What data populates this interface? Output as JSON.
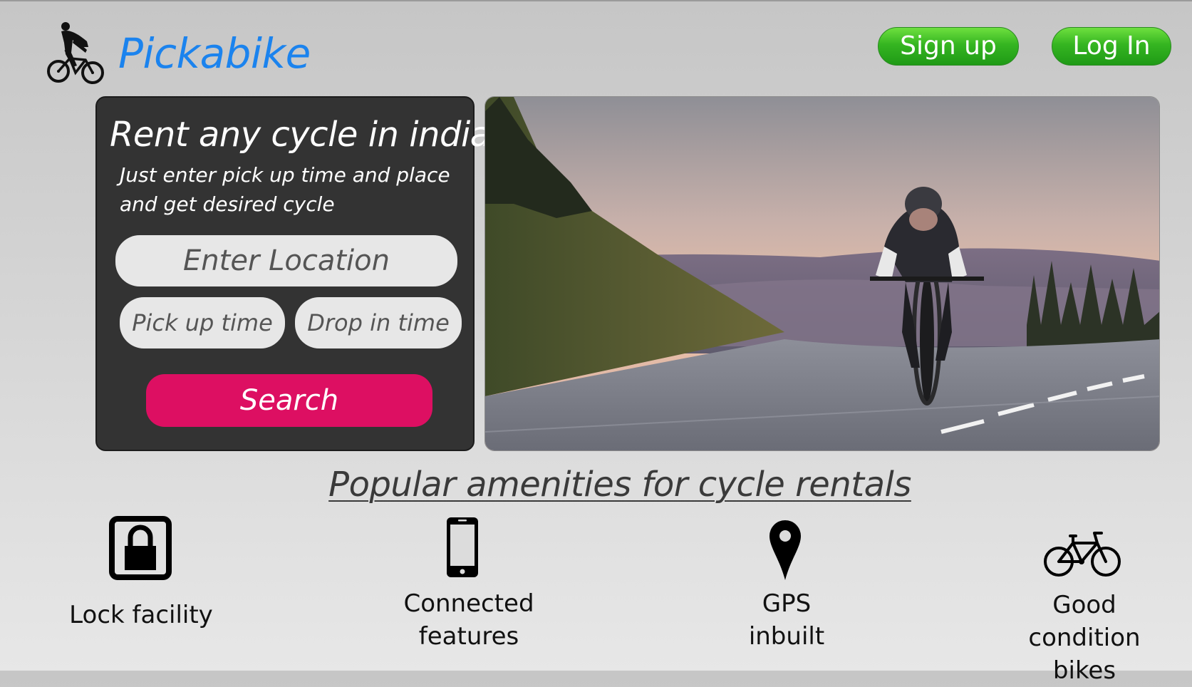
{
  "header": {
    "brand": "Pickabike",
    "signup_label": "Sign up",
    "login_label": "Log In"
  },
  "search_panel": {
    "title": "Rent any cycle in india",
    "subtitle": "Just enter pick up time and place and get desired cycle",
    "location_placeholder": "Enter Location",
    "pickup_placeholder": "Pick up time",
    "drop_placeholder": "Drop in time",
    "search_label": "Search"
  },
  "amenities": {
    "title": "Popular amenities for cycle rentals",
    "items": [
      {
        "icon": "lock-icon",
        "label": "Lock facility"
      },
      {
        "icon": "phone-icon",
        "label": "Connected features"
      },
      {
        "icon": "location-pin-icon",
        "label": "GPS inbuilt"
      },
      {
        "icon": "bicycle-icon",
        "label": "Good condition bikes"
      }
    ]
  },
  "colors": {
    "brand": "#1b83ee",
    "button_green": "#35b521",
    "search_pink": "#dd0f62",
    "panel_dark": "#333333"
  }
}
